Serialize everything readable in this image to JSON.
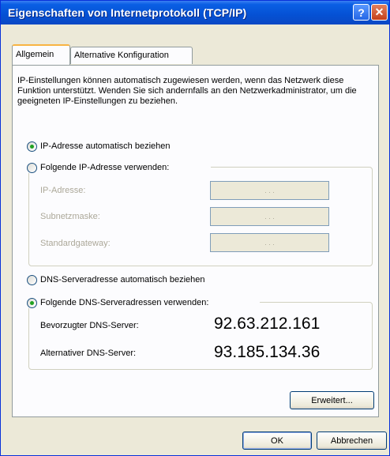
{
  "window": {
    "title": "Eigenschaften von Internetprotokoll (TCP/IP)",
    "help_glyph": "?",
    "close_glyph": "✕"
  },
  "tabs": [
    {
      "label": "Allgemein",
      "active": true
    },
    {
      "label": "Alternative Konfiguration",
      "active": false
    }
  ],
  "description": "IP-Einstellungen können automatisch zugewiesen werden, wenn das Netzwerk diese Funktion unterstützt. Wenden Sie sich andernfalls an den Netzwerkadministrator, um die geeigneten IP-Einstellungen zu beziehen.",
  "ip": {
    "auto_label": "IP-Adresse automatisch beziehen",
    "auto_selected": true,
    "manual_label": "Folgende IP-Adresse verwenden:",
    "manual_selected": false,
    "fields": [
      {
        "label": "IP-Adresse:",
        "value": ".   .   ."
      },
      {
        "label": "Subnetzmaske:",
        "value": ".   .   ."
      },
      {
        "label": "Standardgateway:",
        "value": ".   .   ."
      }
    ]
  },
  "dns": {
    "auto_label": "DNS-Serveradresse automatisch beziehen",
    "auto_selected": false,
    "manual_label": "Folgende DNS-Serveradressen verwenden:",
    "manual_selected": true,
    "preferred_label": "Bevorzugter DNS-Server:",
    "preferred_value": "92.63.212.161",
    "alternate_label": "Alternativer DNS-Server:",
    "alternate_value": "93.185.134.36"
  },
  "buttons": {
    "advanced": "Erweitert...",
    "ok": "OK",
    "cancel": "Abbrechen"
  }
}
